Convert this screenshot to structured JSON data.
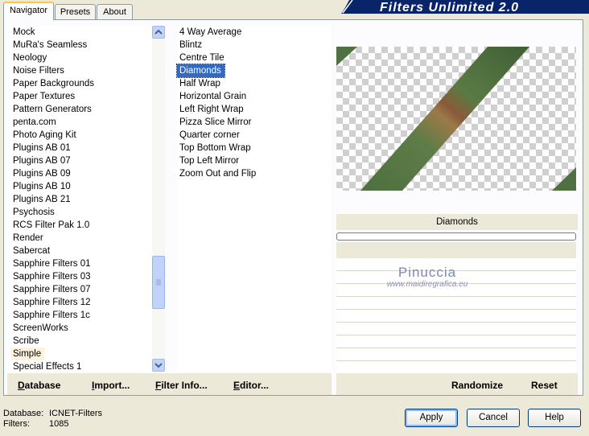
{
  "tabs": [
    "Navigator",
    "Presets",
    "About"
  ],
  "banner_title": "Filters Unlimited 2.0",
  "categories": [
    "Mock",
    "MuRa's Seamless",
    "Neology",
    "Noise Filters",
    "Paper Backgrounds",
    "Paper Textures",
    "Pattern Generators",
    "penta.com",
    "Photo Aging Kit",
    "Plugins AB 01",
    "Plugins AB 07",
    "Plugins AB 09",
    "Plugins AB 10",
    "Plugins AB 21",
    "Psychosis",
    "RCS Filter Pak 1.0",
    "Render",
    "Sabercat",
    "Sapphire Filters 01",
    "Sapphire Filters 03",
    "Sapphire Filters 07",
    "Sapphire Filters 12",
    "Sapphire Filters 1c",
    "ScreenWorks",
    "Scribe",
    "Simple",
    "Special Effects 1"
  ],
  "highlighted_category": "Simple",
  "filters": [
    "4 Way Average",
    "Blintz",
    "Centre Tile",
    "Diamonds",
    "Half Wrap",
    "Horizontal Grain",
    "Left Right Wrap",
    "Pizza Slice Mirror",
    "Quarter corner",
    "Top Bottom Wrap",
    "Top Left Mirror",
    "Zoom Out and Flip"
  ],
  "selected_filter": "Diamonds",
  "filter_name_label": "Diamonds",
  "watermark": {
    "name": "Pinuccia",
    "url": "www.maidiregrafica.eu"
  },
  "left_buttons": [
    {
      "label": "Database",
      "accel": "D"
    },
    {
      "label": "Import...",
      "accel": "I"
    },
    {
      "label": "Filter Info...",
      "accel": "F"
    },
    {
      "label": "Editor...",
      "accel": "E"
    }
  ],
  "right_buttons": {
    "randomize": "Randomize",
    "reset": "Reset"
  },
  "status": {
    "database_label": "Database:",
    "database_value": "ICNET-Filters",
    "filters_label": "Filters:",
    "filters_value": "1085"
  },
  "dialog_buttons": {
    "apply": "Apply",
    "cancel": "Cancel",
    "help": "Help"
  },
  "colors": {
    "selection": "#316ac5",
    "banner": "#0a246a",
    "accent_tab": "#ffc83c"
  }
}
